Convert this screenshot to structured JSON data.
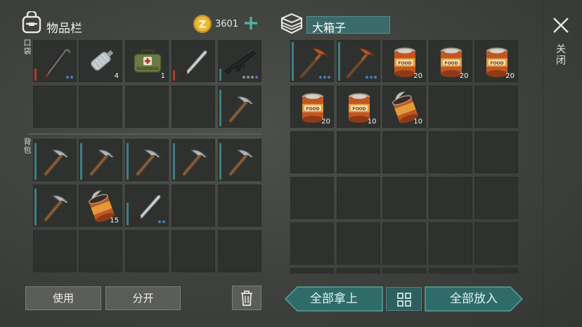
{
  "inventory": {
    "title": "物品栏",
    "pocket_label": "口袋",
    "backpack_label": "背包",
    "coins": "3601",
    "pocket_slots": [
      {
        "item": "crowbar",
        "qty": "",
        "dots": 2,
        "bar": "red",
        "level": 0.3
      },
      {
        "item": "water-bottle",
        "qty": "4",
        "dots": 0,
        "bar": "",
        "level": 0
      },
      {
        "item": "first-aid-bag",
        "qty": "1",
        "dots": 0,
        "bar": "",
        "level": 0
      },
      {
        "item": "machete",
        "qty": "",
        "dots": 0,
        "bar": "red",
        "level": 0.25
      },
      {
        "item": "assault-rifle",
        "qty": "",
        "dots": 4,
        "bar": "teal",
        "level": 0.3
      },
      {
        "item": "",
        "qty": "",
        "dots": 0,
        "bar": "",
        "level": 0
      },
      {
        "item": "",
        "qty": "",
        "dots": 0,
        "bar": "",
        "level": 0
      },
      {
        "item": "",
        "qty": "",
        "dots": 0,
        "bar": "",
        "level": 0
      },
      {
        "item": "",
        "qty": "",
        "dots": 0,
        "bar": "",
        "level": 0
      },
      {
        "item": "pickaxe",
        "qty": "",
        "dots": 0,
        "bar": "teal",
        "level": 0.9
      }
    ],
    "backpack_slots": [
      {
        "item": "pickaxe",
        "qty": "",
        "dots": 0,
        "bar": "teal",
        "level": 0.9
      },
      {
        "item": "pickaxe",
        "qty": "",
        "dots": 0,
        "bar": "teal",
        "level": 0.9
      },
      {
        "item": "pickaxe",
        "qty": "",
        "dots": 0,
        "bar": "teal",
        "level": 0.9
      },
      {
        "item": "pickaxe",
        "qty": "",
        "dots": 0,
        "bar": "teal",
        "level": 0.9
      },
      {
        "item": "pickaxe",
        "qty": "",
        "dots": 0,
        "bar": "teal",
        "level": 0.9
      },
      {
        "item": "pickaxe",
        "qty": "",
        "dots": 0,
        "bar": "teal",
        "level": 0.9
      },
      {
        "item": "open-can",
        "qty": "15",
        "dots": 0,
        "bar": "",
        "level": 0
      },
      {
        "item": "machete",
        "qty": "",
        "dots": 2,
        "bar": "teal",
        "level": 0.55
      },
      {
        "item": "",
        "qty": "",
        "dots": 0,
        "bar": "",
        "level": 0
      },
      {
        "item": "",
        "qty": "",
        "dots": 0,
        "bar": "",
        "level": 0
      },
      {
        "item": "",
        "qty": "",
        "dots": 0,
        "bar": "",
        "level": 0
      },
      {
        "item": "",
        "qty": "",
        "dots": 0,
        "bar": "",
        "level": 0
      },
      {
        "item": "",
        "qty": "",
        "dots": 0,
        "bar": "",
        "level": 0
      },
      {
        "item": "",
        "qty": "",
        "dots": 0,
        "bar": "",
        "level": 0
      },
      {
        "item": "",
        "qty": "",
        "dots": 0,
        "bar": "",
        "level": 0
      }
    ],
    "use_label": "使用",
    "split_label": "分开"
  },
  "box": {
    "title": "大箱子",
    "slots": [
      {
        "item": "copper-pickaxe",
        "qty": "",
        "dots": 3,
        "bar": "teal",
        "level": 0.95
      },
      {
        "item": "copper-pickaxe",
        "qty": "",
        "dots": 3,
        "bar": "teal",
        "level": 0.95
      },
      {
        "item": "food-can",
        "qty": "20",
        "dots": 0,
        "bar": "",
        "level": 0
      },
      {
        "item": "food-can",
        "qty": "20",
        "dots": 0,
        "bar": "",
        "level": 0
      },
      {
        "item": "food-can",
        "qty": "20",
        "dots": 0,
        "bar": "",
        "level": 0
      },
      {
        "item": "food-can",
        "qty": "20",
        "dots": 0,
        "bar": "",
        "level": 0
      },
      {
        "item": "food-can",
        "qty": "10",
        "dots": 0,
        "bar": "",
        "level": 0
      },
      {
        "item": "open-can",
        "qty": "10",
        "dots": 0,
        "bar": "",
        "level": 0
      }
    ],
    "take_all_label": "全部拿上",
    "put_all_label": "全部放入"
  },
  "close_label": "关闭",
  "colors": {
    "accent_teal": "#3b6a6c",
    "durability_teal": "#3d7e86",
    "durability_red": "#b33a2c",
    "coin": "#e0b52f"
  }
}
